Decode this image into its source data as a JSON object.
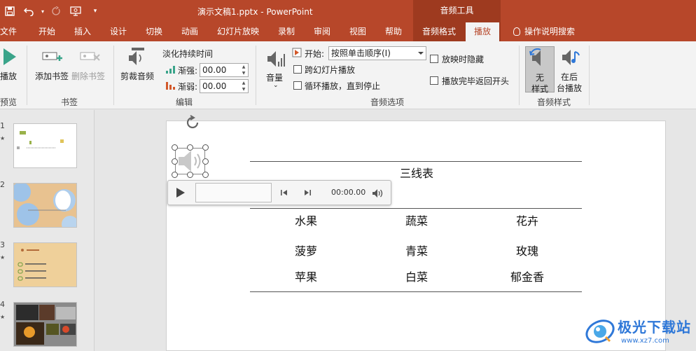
{
  "titlebar": {
    "document_title": "演示文稿1.pptx  -  PowerPoint",
    "context_tool": "音频工具"
  },
  "tabs": {
    "file": "文件",
    "home": "开始",
    "insert": "插入",
    "design": "设计",
    "transitions": "切换",
    "animations": "动画",
    "slideshow": "幻灯片放映",
    "record": "录制",
    "review": "审阅",
    "view": "视图",
    "help": "帮助",
    "audio_format": "音频格式",
    "playback": "播放",
    "tell_me": "操作说明搜索"
  },
  "ribbon": {
    "preview": {
      "play_label": "播放",
      "group": "预览"
    },
    "bookmarks": {
      "add": "添加书签",
      "remove": "删除书签",
      "group": "书签"
    },
    "editing": {
      "trim": "剪裁音频",
      "fade_title": "淡化持续时间",
      "fade_in_label": "渐强:",
      "fade_in_value": "00.00",
      "fade_out_label": "渐弱:",
      "fade_out_value": "00.00",
      "group": "编辑"
    },
    "audio_options": {
      "volume": "音量",
      "start_label": "开始:",
      "start_value": "按照单击顺序(I)",
      "play_across_slides": "跨幻灯片播放",
      "loop_until_stopped": "循环播放，直到停止",
      "hide_during_show": "放映时隐藏",
      "rewind_after_playing": "播放完毕返回开头",
      "group": "音频选项"
    },
    "audio_styles": {
      "no_style_line1": "无",
      "no_style_line2": "样式",
      "play_bg_line1": "在后",
      "play_bg_line2": "台播放",
      "group": "音频样式"
    }
  },
  "thumbnails": [
    {
      "number": "1",
      "star": "★"
    },
    {
      "number": "2",
      "star": ""
    },
    {
      "number": "3",
      "star": "★"
    },
    {
      "number": "4",
      "star": "★"
    }
  ],
  "slide": {
    "table": {
      "title": "三线表",
      "headers": [
        "水果",
        "蔬菜",
        "花卉"
      ],
      "rows": [
        [
          "菠萝",
          "青菜",
          "玫瑰"
        ],
        [
          "苹果",
          "白菜",
          "郁金香"
        ]
      ]
    },
    "player": {
      "time": "00:00.00"
    }
  },
  "watermark": {
    "name": "极光下载站",
    "url": "www.xz7.com"
  },
  "colors": {
    "accent": "#b7472a",
    "context": "#9e3a1f",
    "watermark": "#2f78d8"
  }
}
